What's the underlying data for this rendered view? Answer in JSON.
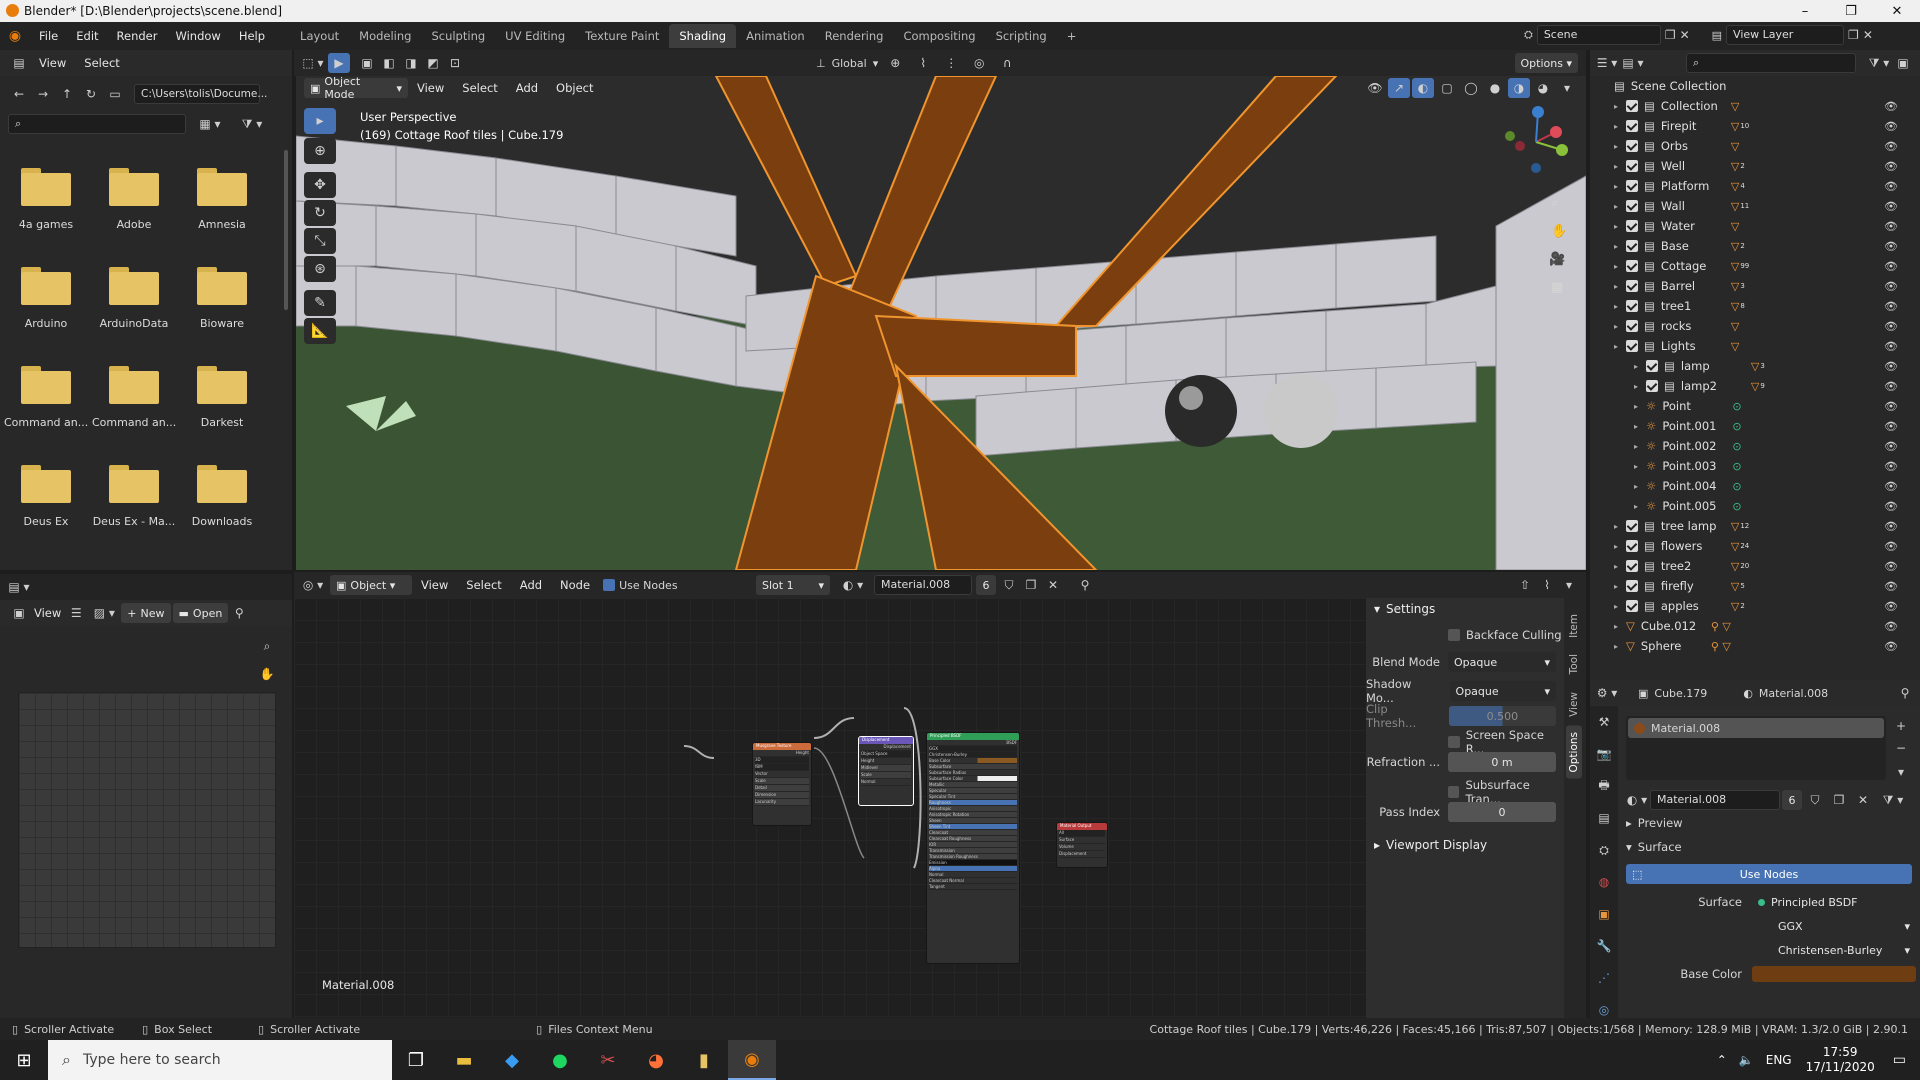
{
  "window": {
    "title": "Blender* [D:\\Blender\\projects\\scene.blend]",
    "minimize": "–",
    "maximize": "❐",
    "close": "✕"
  },
  "menu": [
    "File",
    "Edit",
    "Render",
    "Window",
    "Help"
  ],
  "workspaces": [
    "Layout",
    "Modeling",
    "Sculpting",
    "UV Editing",
    "Texture Paint",
    "Shading",
    "Animation",
    "Rendering",
    "Compositing",
    "Scripting"
  ],
  "workspace_add": "+",
  "scene": {
    "name": "Scene",
    "view_layer": "View Layer"
  },
  "filebrowser": {
    "header": {
      "view": "View",
      "select": "Select"
    },
    "path": "C:\\Users\\tolis\\Docume...",
    "folders": [
      "4a games",
      "Adobe",
      "Amnesia",
      "Arduino",
      "ArduinoData",
      "Bioware",
      "Command an...",
      "Command an...",
      "Darkest",
      "Deus Ex",
      "Deus Ex - Ma...",
      "Downloads"
    ]
  },
  "image_editor": {
    "view": "View",
    "new": "New",
    "open": "Open"
  },
  "viewport": {
    "mode": "Object Mode",
    "menus": [
      "View",
      "Select",
      "Add",
      "Object"
    ],
    "transform": "Global",
    "options": "Options",
    "overlay_title": "User Perspective",
    "overlay_sub": "(169) Cottage Roof tiles | Cube.179",
    "gizmo": {
      "x": "X",
      "y": "Y",
      "z": "Z"
    }
  },
  "node_editor": {
    "type": "Object",
    "menus": [
      "View",
      "Select",
      "Add",
      "Node"
    ],
    "use_nodes": "Use Nodes",
    "slot": "Slot 1",
    "material": "Material.008",
    "users": "6",
    "footer": "Material.008",
    "nodes": {
      "musgrave": "Musgrave Texture",
      "displacement": "Displacement",
      "bsdf": "Principled BSDF",
      "output": "Material Output",
      "bsdf_name": "BSDF",
      "bsdf_value": "GGX",
      "bsdf_rows": [
        "Christensen-Burley",
        "Base Color",
        "Subsurface",
        "Subsurface Radius",
        "Subsurface Color",
        "Metallic",
        "Specular",
        "Specular Tint",
        "Roughness",
        "Anisotropic",
        "Anisotropic Rotation",
        "Sheen",
        "Sheen Tint",
        "Clearcoat",
        "Clearcoat Roughness",
        "IOR",
        "Transmission",
        "Transmission Roughness",
        "Emission",
        "Alpha",
        "Normal",
        "Clearcoat Normal",
        "Tangent"
      ],
      "musgrave_rows": [
        "Height",
        "3D",
        "fBM",
        "Vector",
        "Scale",
        "Detail",
        "Dimension",
        "Lacunarity"
      ],
      "disp_rows": [
        "Displacement",
        "Object Space",
        "Height",
        "Midlevel",
        "Scale",
        "Normal"
      ],
      "output_rows": [
        "All",
        "Surface",
        "Volume",
        "Displacement"
      ]
    },
    "sidebar": {
      "tabs": [
        "Item",
        "Tool",
        "View",
        "Options"
      ],
      "settings": "Settings",
      "backface": "Backface Culling",
      "blend_label": "Blend Mode",
      "blend_value": "Opaque",
      "shadow_label": "Shadow Mo...",
      "shadow_value": "Opaque",
      "clip_label": "Clip Thresh...",
      "clip_value": "0.500",
      "ssr": "Screen Space R...",
      "refraction_label": "Refraction ...",
      "refraction_value": "0 m",
      "sss": "Subsurface Tran...",
      "pass_label": "Pass Index",
      "pass_value": "0",
      "viewport_display": "Viewport Display"
    }
  },
  "outliner": {
    "scene_collection": "Scene Collection",
    "items": [
      {
        "name": "Collection",
        "badge": ""
      },
      {
        "name": "Firepit",
        "badge": "10"
      },
      {
        "name": "Orbs",
        "badge": ""
      },
      {
        "name": "Well",
        "badge": "2"
      },
      {
        "name": "Platform",
        "badge": "4"
      },
      {
        "name": "Wall",
        "badge": "11"
      },
      {
        "name": "Water",
        "badge": ""
      },
      {
        "name": "Base",
        "badge": "2"
      },
      {
        "name": "Cottage",
        "badge": "99"
      },
      {
        "name": "Barrel",
        "badge": "3"
      },
      {
        "name": "tree1",
        "badge": "8"
      },
      {
        "name": "rocks",
        "badge": ""
      },
      {
        "name": "Lights",
        "badge": ""
      },
      {
        "name": "lamp",
        "badge": "3"
      },
      {
        "name": "lamp2",
        "badge": "9"
      },
      {
        "name": "Point",
        "badge": ""
      },
      {
        "name": "Point.001",
        "badge": ""
      },
      {
        "name": "Point.002",
        "badge": ""
      },
      {
        "name": "Point.003",
        "badge": ""
      },
      {
        "name": "Point.004",
        "badge": ""
      },
      {
        "name": "Point.005",
        "badge": ""
      },
      {
        "name": "tree lamp",
        "badge": "12"
      },
      {
        "name": "flowers",
        "badge": "24"
      },
      {
        "name": "tree2",
        "badge": "20"
      },
      {
        "name": "firefly",
        "badge": "5"
      },
      {
        "name": "apples",
        "badge": "2"
      },
      {
        "name": "Cube.012",
        "badge": ""
      },
      {
        "name": "Sphere",
        "badge": ""
      }
    ]
  },
  "properties": {
    "object": "Cube.179",
    "material": "Material.008",
    "slot_name": "Material.008",
    "mat_field": "Material.008",
    "users": "6",
    "preview": "Preview",
    "surface": "Surface",
    "use_nodes": "Use Nodes",
    "surface_label": "Surface",
    "surface_value": "Principled BSDF",
    "dist": "GGX",
    "sss_method": "Christensen-Burley",
    "base_color": "Base Color"
  },
  "status": {
    "left1": "Scroller Activate",
    "left2": "Box Select",
    "left3": "Scroller Activate",
    "left4": "Files Context Menu",
    "right": "Cottage Roof tiles | Cube.179 | Verts:46,226 | Faces:45,166 | Tris:87,507 | Objects:1/568 | Memory: 128.9 MiB | VRAM: 1.3/2.0 GiB | 2.90.1"
  },
  "taskbar": {
    "search": "Type here to search",
    "lang": "ENG",
    "time": "17:59",
    "date": "17/11/2020"
  },
  "colors": {
    "accent": "#4772b3",
    "selection": "#e8963c",
    "header": "#2a2a2a",
    "panel": "#303030"
  }
}
